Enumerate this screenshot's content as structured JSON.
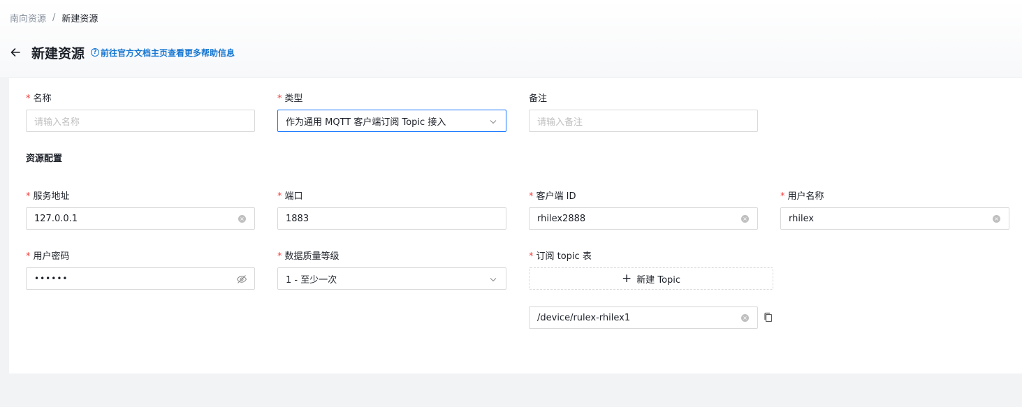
{
  "breadcrumb": {
    "parent": "南向资源",
    "separator": "/",
    "current": "新建资源"
  },
  "header": {
    "title": "新建资源",
    "help_icon": "?",
    "help_link": "前往官方文档主页查看更多帮助信息"
  },
  "form": {
    "name": {
      "label": "名称",
      "placeholder": "请输入名称",
      "required": "*"
    },
    "type": {
      "label": "类型",
      "value": "作为通用 MQTT 客户端订阅 Topic 接入",
      "required": "*"
    },
    "remark": {
      "label": "备注",
      "placeholder": "请输入备注"
    },
    "section_title": "资源配置",
    "host": {
      "label": "服务地址",
      "value": "127.0.0.1",
      "required": "*"
    },
    "port": {
      "label": "端口",
      "value": "1883",
      "required": "*"
    },
    "client_id": {
      "label": "客户端 ID",
      "value": "rhilex2888",
      "required": "*"
    },
    "username": {
      "label": "用户名称",
      "value": "rhilex",
      "required": "*"
    },
    "password": {
      "label": "用户密码",
      "value": "••••••",
      "required": "*"
    },
    "qos": {
      "label": "数据质量等级",
      "value": "1 - 至少一次",
      "required": "*"
    },
    "topics": {
      "label": "订阅 topic 表",
      "required": "*",
      "add_plus": "+",
      "add_label": "新建 Topic",
      "items": [
        "/device/rulex-rhilex1"
      ]
    }
  },
  "icons": {
    "back": "arrow-left-icon",
    "help": "question-circle-icon",
    "clear": "close-circle-icon",
    "chevron": "chevron-down-icon",
    "eye": "eye-invisible-icon",
    "copy": "copy-icon",
    "plus": "plus-icon"
  },
  "colors": {
    "primary": "#1677ff",
    "link": "#1677d2",
    "required": "#f53f3f"
  }
}
